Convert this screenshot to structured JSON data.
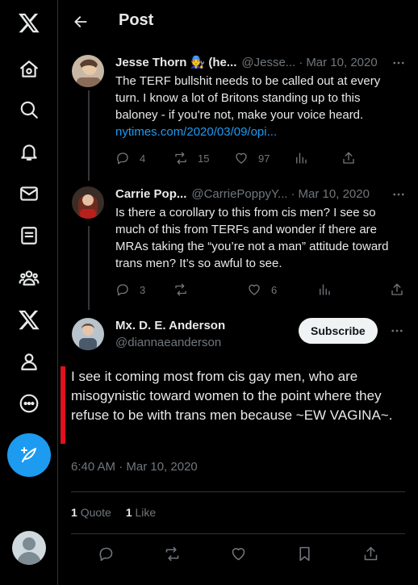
{
  "header": {
    "title": "Post"
  },
  "replies": [
    {
      "name": "Jesse Thorn 🧑‍🔧 (he...",
      "handle": "@Jesse...",
      "dot": "·",
      "date": "Mar 10, 2020",
      "text": "The TERF bullshit needs to be called out at every turn. I know a lot of Britons standing up to this baloney - if you're not, make your voice heard.",
      "link": "nytimes.com/2020/03/09/opi...",
      "replies": "4",
      "reposts": "15",
      "likes": "97"
    },
    {
      "name": "Carrie Pop...",
      "handle": "@CarriePoppyY...",
      "dot": "·",
      "date": "Mar 10, 2020",
      "text": "Is there a corollary to this from cis men? I see so much of this from TERFs and wonder if there are MRAs taking the “you’re not a man” attitude toward trans men? It’s so awful to see.",
      "replies": "3",
      "likes": "6"
    }
  ],
  "main_post": {
    "name": "Mx. D. E. Anderson",
    "handle": "@diannaeanderson",
    "subscribe_label": "Subscribe",
    "text": "I see it coming most from cis gay men, who are misogynistic toward women to the point where they refuse to be with trans men because ~EW VAGINA~.",
    "timestamp": "6:40 AM · Mar 10, 2020",
    "quote_count": "1",
    "quote_label": "Quote",
    "like_count": "1",
    "like_label": "Like"
  },
  "colors": {
    "accent": "#1d9bf0",
    "text": "#e7e9ea",
    "muted": "#71767b",
    "background": "#000000",
    "highlight_bar": "#e0101e"
  },
  "icons": {
    "nav": [
      "x-logo-icon",
      "home-icon",
      "search-icon",
      "notifications-icon",
      "messages-icon",
      "lists-icon",
      "communities-icon",
      "premium-x-icon",
      "profile-icon",
      "more-circle-icon"
    ],
    "compose": "compose-post-icon"
  }
}
